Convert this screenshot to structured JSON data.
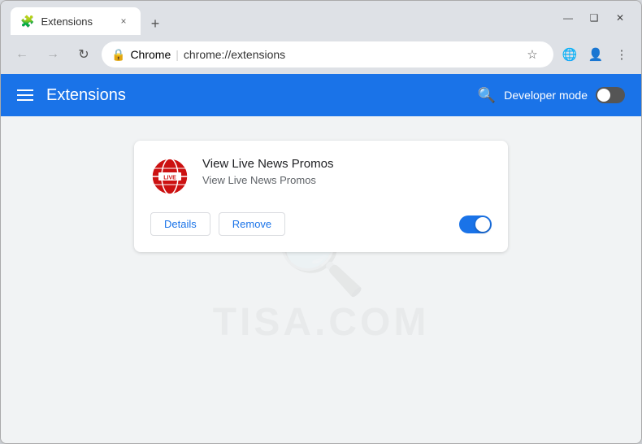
{
  "window": {
    "title": "Extensions",
    "tab_close": "×",
    "new_tab": "+",
    "minimize": "—",
    "maximize": "❑",
    "close": "✕"
  },
  "addressbar": {
    "back": "←",
    "forward": "→",
    "reload": "↻",
    "secure_icon": "🔒",
    "site_name": "Chrome",
    "divider": "|",
    "url": "chrome://extensions",
    "bookmark_icon": "☆",
    "translate_icon": "⊕",
    "account_icon": "👤",
    "menu_icon": "⋮"
  },
  "header": {
    "title": "Extensions",
    "developer_mode_label": "Developer mode",
    "developer_mode_on": false
  },
  "extension": {
    "name": "View Live News Promos",
    "description": "View Live News Promos",
    "details_label": "Details",
    "remove_label": "Remove",
    "enabled": true
  },
  "watermark": {
    "text": "TISA.COM"
  }
}
